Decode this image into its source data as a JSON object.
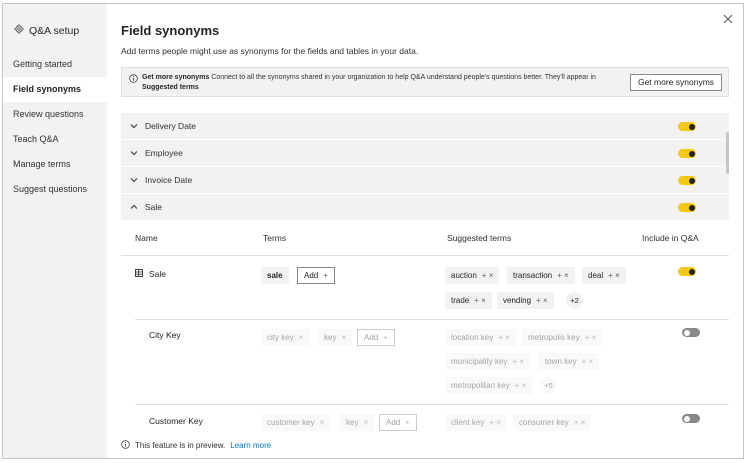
{
  "sidebar": {
    "title": "Q&A setup",
    "items": [
      {
        "label": "Getting started"
      },
      {
        "label": "Field synonyms"
      },
      {
        "label": "Review questions"
      },
      {
        "label": "Teach Q&A"
      },
      {
        "label": "Manage terms"
      },
      {
        "label": "Suggest questions"
      }
    ],
    "active_index": 1
  },
  "header": {
    "title": "Field synonyms",
    "subtitle": "Add terms people might use as synonyms for the fields and tables in your data."
  },
  "banner": {
    "bold": "Get more synonyms",
    "text": " Connect to all the synonyms shared in your organization to help Q&A understand people's questions better. They'll appear in ",
    "bold2": "Suggested terms",
    "button": "Get more synonyms"
  },
  "tables": [
    {
      "name": "Delivery Date",
      "expanded": false,
      "include": true
    },
    {
      "name": "Employee",
      "expanded": false,
      "include": true
    },
    {
      "name": "Invoice Date",
      "expanded": false,
      "include": true
    },
    {
      "name": "Sale",
      "expanded": true,
      "include": true
    }
  ],
  "columns": {
    "name": "Name",
    "terms": "Terms",
    "suggested": "Suggested terms",
    "include": "Include in Q&A"
  },
  "rows": [
    {
      "name": "Sale",
      "terms": [
        "sale"
      ],
      "add": "Add",
      "suggested": [
        "auction",
        "transaction",
        "deal",
        "trade",
        "vending"
      ],
      "more": "+2",
      "include": true
    },
    {
      "name": "City Key",
      "terms": [
        "city key",
        "key"
      ],
      "add": "Add",
      "suggested": [
        "location key",
        "metropolis key",
        "municipality key",
        "town key",
        "metropolitan key"
      ],
      "more": "+5",
      "include": false
    },
    {
      "name": "Customer Key",
      "terms": [
        "customer key",
        "key"
      ],
      "add": "Add",
      "suggested": [
        "client key",
        "consumer key"
      ],
      "include": false
    }
  ],
  "footer": {
    "text": "This feature is in preview.",
    "link": "Learn more"
  },
  "colors": {
    "toggle_on": "#f2c811",
    "toggle_off": "#8a8886",
    "sidebar_bg": "#f3f2f1",
    "link": "#0078d4"
  },
  "icons": {
    "settings": "gear-icon",
    "close": "close-icon",
    "info": "info-icon",
    "chevron_down": "chevron-down-icon",
    "chevron_up": "chevron-up-icon",
    "table": "table-icon"
  }
}
